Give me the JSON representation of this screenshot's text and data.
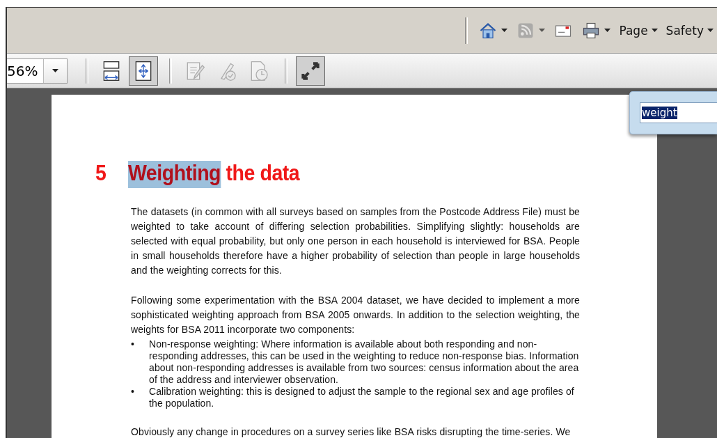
{
  "command_bar": {
    "items": [
      {
        "kind": "icon",
        "disabled": false
      },
      {
        "kind": "icon",
        "disabled": true
      },
      {
        "kind": "icon",
        "disabled": false
      },
      {
        "kind": "icon",
        "disabled": false
      },
      {
        "kind": "menu",
        "label": "Page"
      },
      {
        "kind": "menu",
        "label": "Safety"
      }
    ]
  },
  "toolbar": {
    "zoom": {
      "value": "56%"
    },
    "buttons": [
      {
        "selected": false,
        "disabled": false
      },
      {
        "selected": true,
        "disabled": false
      },
      {
        "selected": false,
        "disabled": true
      },
      {
        "selected": false,
        "disabled": true
      },
      {
        "selected": false,
        "disabled": true
      },
      {
        "selected": true,
        "disabled": false
      }
    ]
  },
  "find": {
    "value": "weight"
  },
  "document": {
    "heading": {
      "number": "5",
      "parts": [
        {
          "text": "Weighting",
          "highlighted": true
        },
        {
          "text": "the data",
          "highlighted": false
        }
      ]
    },
    "blocks": [
      {
        "kind": "paragraph",
        "text": "The datasets (in common with all surveys based on samples from the Postcode Address File) must be weighted to take account of differing selection probabilities. Simplifying slightly: households are selected with equal probability, but only one person in each household is interviewed for BSA. People in small households therefore have a higher probability of selection than people in large households and the weighting corrects for this."
      },
      {
        "kind": "paragraph",
        "text": "Following some experimentation with the BSA 2004 dataset, we have decided to implement a more sophisticated weighting approach from BSA 2005 onwards. In addition to the selection weighting, the weights for BSA 2011 incorporate two components:"
      },
      {
        "kind": "bullets",
        "bullet": "•",
        "items": [
          "Non-response weighting: Where information is available about both responding and non-responding addresses, this can be used in the weighting to reduce non-response bias. Information about non-responding addresses is available from two sources: census information about the area of the address and interviewer observation.",
          "Calibration weighting: this is designed to adjust the sample to the regional sex and age profiles of the population."
        ]
      },
      {
        "kind": "paragraph",
        "text": "Obviously any change in procedures on a survey series like BSA risks disrupting the time-series. We"
      }
    ]
  }
}
